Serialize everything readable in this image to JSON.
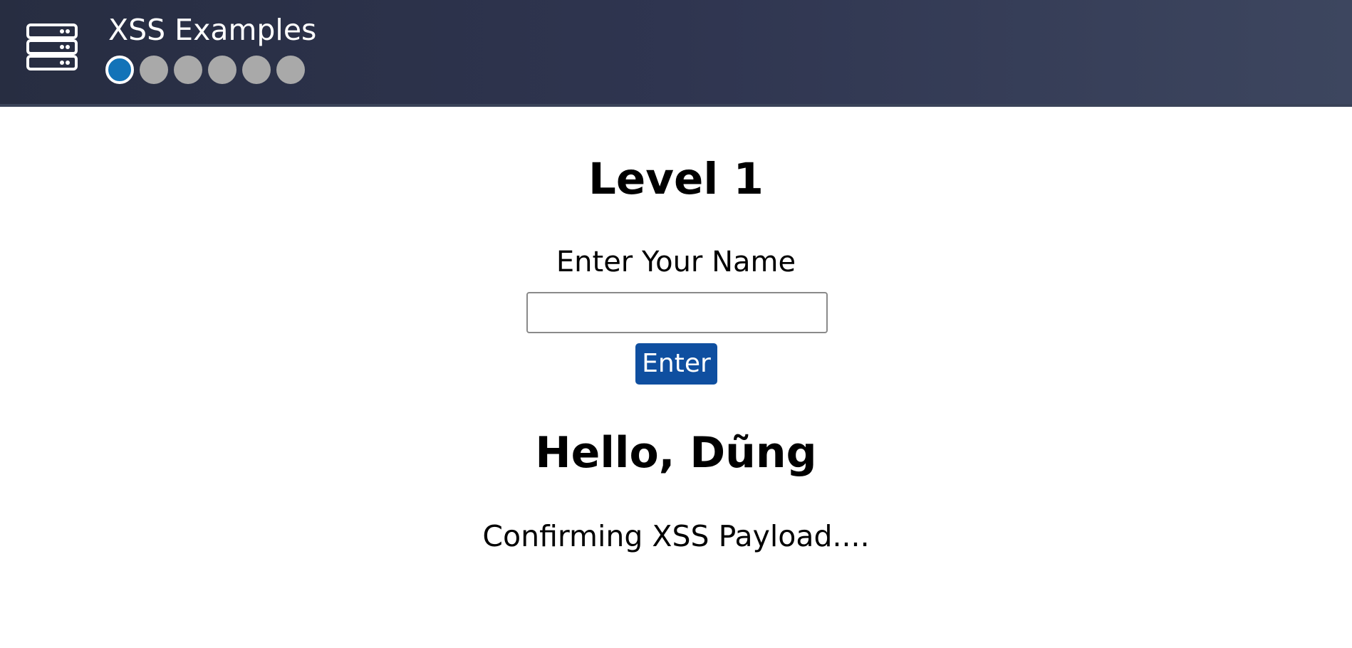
{
  "header": {
    "title": "XSS Examples",
    "logo_icon": "server-stack-icon",
    "levels": [
      {
        "number": 1,
        "active": true
      },
      {
        "number": 2,
        "active": false
      },
      {
        "number": 3,
        "active": false
      },
      {
        "number": 4,
        "active": false
      },
      {
        "number": 5,
        "active": false
      },
      {
        "number": 6,
        "active": false
      }
    ],
    "colors": {
      "bar_background": "#2c3248",
      "dot_active": "#1273b8",
      "dot_inactive": "#a9a9a9"
    }
  },
  "main": {
    "heading": "Level 1",
    "form": {
      "label": "Enter Your Name",
      "input_value": "",
      "button_label": "Enter",
      "button_color": "#0f4fa0"
    },
    "greeting": "Hello, Dũng",
    "status": "Confirming XSS Payload...."
  }
}
